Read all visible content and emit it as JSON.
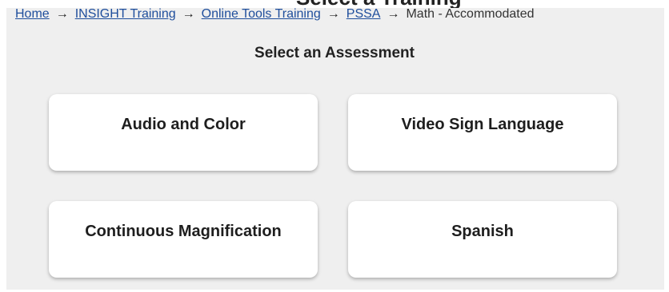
{
  "header": {
    "clipped_title": "Select a Training"
  },
  "breadcrumb": {
    "items": [
      {
        "label": "Home"
      },
      {
        "label": "INSIGHT Training"
      },
      {
        "label": "Online Tools Training"
      },
      {
        "label": "PSSA"
      }
    ],
    "current": "Math - Accommodated",
    "separator": "→"
  },
  "main": {
    "heading": "Select an Assessment",
    "cards": [
      {
        "label": "Audio and Color"
      },
      {
        "label": "Video Sign Language"
      },
      {
        "label": "Continuous Magnification"
      },
      {
        "label": "Spanish"
      }
    ]
  },
  "colors": {
    "background": "#efefef",
    "link": "#1f4e9c",
    "card": "#ffffff",
    "text": "#222222"
  }
}
